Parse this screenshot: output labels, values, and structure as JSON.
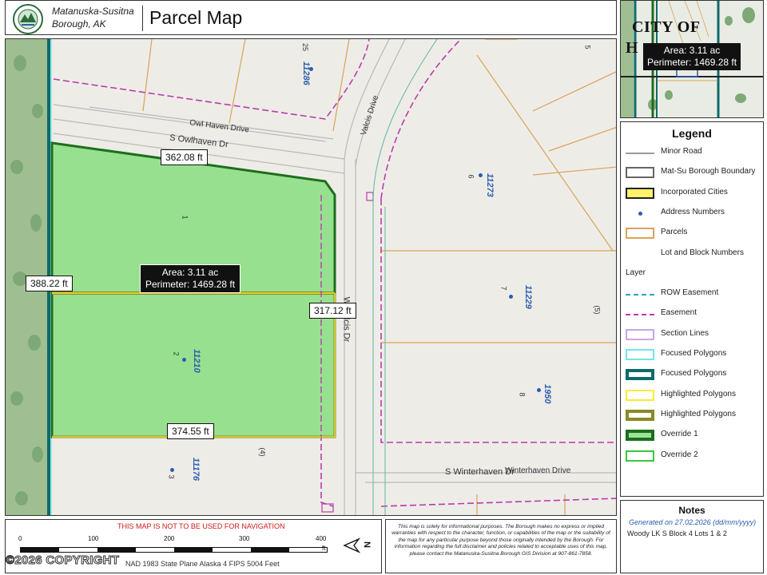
{
  "header": {
    "org_line1": "Matanuska-Susitna",
    "org_line2": "Borough, AK",
    "title": "Parcel Map"
  },
  "map": {
    "roads": {
      "owl_haven_drive": "Owl Haven Drive",
      "s_owlhaven_dr": "S Owlhaven Dr",
      "valcis_drive": "Valcis Drive",
      "w_valcis_dr": "W Valcis Dr",
      "s_winterhaven_dr": "S Winterhaven Dr",
      "winterhaven_drive": "Winterhaven Drive"
    },
    "lot_numbers": [
      "25",
      "5",
      "6",
      "1",
      "7",
      "(5)",
      "2",
      "8",
      "(4)",
      "3"
    ],
    "addresses": [
      "11286",
      "11273",
      "11229",
      "11210",
      "1950",
      "11176"
    ],
    "measurements": {
      "top": "362.08 ft",
      "left": "388.22 ft",
      "right": "317.12 ft",
      "bottom": "374.55 ft"
    },
    "area": {
      "area": "Area: 3.11 ac",
      "perimeter": "Perimeter: 1469.28 ft"
    }
  },
  "inset": {
    "city_line1": "CITY OF",
    "city_line2": "H",
    "area": "Area: 3.11 ac",
    "perimeter": "Perimeter: 1469.28 ft"
  },
  "legend": {
    "title": "Legend",
    "items": [
      {
        "label": "Minor Road",
        "swatch": "line",
        "color": "#9a9a9a"
      },
      {
        "label": "Mat-Su Borough Boundary",
        "swatch": "box",
        "color": "#666666",
        "fill": "#ffffff"
      },
      {
        "label": "Incorporated Cities",
        "swatch": "box",
        "color": "#222222",
        "fill": "#fff36a"
      },
      {
        "label": "Address Numbers",
        "swatch": "dot",
        "color": "#2a5db0"
      },
      {
        "label": "Parcels",
        "swatch": "box",
        "color": "#d9a35a",
        "fill": "#ffffff"
      },
      {
        "label": "Lot and Block Numbers",
        "swatch": "none",
        "color": ""
      },
      {
        "label": "Layer",
        "swatch": "none",
        "color": ""
      },
      {
        "label": "ROW Easement",
        "swatch": "dashdot",
        "color": "#2aa7b3"
      },
      {
        "label": "Easement",
        "swatch": "dash",
        "color": "#b83dac"
      },
      {
        "label": "Section Lines",
        "swatch": "box",
        "color": "#c9a6e6",
        "fill": "#ffffff"
      },
      {
        "label": "Focused Polygons",
        "swatch": "box",
        "color": "#6fe7ea",
        "fill": "#ffffff"
      },
      {
        "label": "Focused Polygons",
        "swatch": "boxthick",
        "color": "#0e6a6a",
        "fill": "#ffffff"
      },
      {
        "label": "Highlighted Polygons",
        "swatch": "box",
        "color": "#f5ee35",
        "fill": "#ffffff"
      },
      {
        "label": "Highlighted Polygons",
        "swatch": "boxthick",
        "color": "#8a8a26",
        "fill": "#ffffff"
      },
      {
        "label": "Override 1",
        "swatch": "boxthick",
        "color": "#1d6e1d",
        "fill": "#9be59b"
      },
      {
        "label": "Override 2",
        "swatch": "box",
        "color": "#3cc63c",
        "fill": "#ffffff"
      }
    ]
  },
  "notes": {
    "title": "Notes",
    "generated_prefix": "Generated on",
    "generated_date": "27.02.2026",
    "generated_format": "(dd/mm/yyyy)",
    "text": "Woody LK S Block 4 Lots 1 & 2"
  },
  "scale": {
    "warning": "THIS MAP IS NOT TO BE USED FOR NAVIGATION",
    "ticks": [
      "0",
      "100",
      "200",
      "300",
      "400"
    ],
    "unit": "ft",
    "projection": "NAD 1983 State Plane Alaska 4 FIPS 5004 Feet",
    "copyright": "©2026 COPYRIGHT",
    "north_label": "N"
  },
  "disclaimer": "This map is solely for informational purposes. The Borough makes no express or implied warranties with respect to the character, function, or capabilities of the map or the suitability of the map for any particular purpose beyond those originally intended by the Borough. For information regarding the full disclaimer and policies related to acceptable uses of this map, please contact the Matanuska-Susitna Borough GIS Division at 907-861-7858."
}
